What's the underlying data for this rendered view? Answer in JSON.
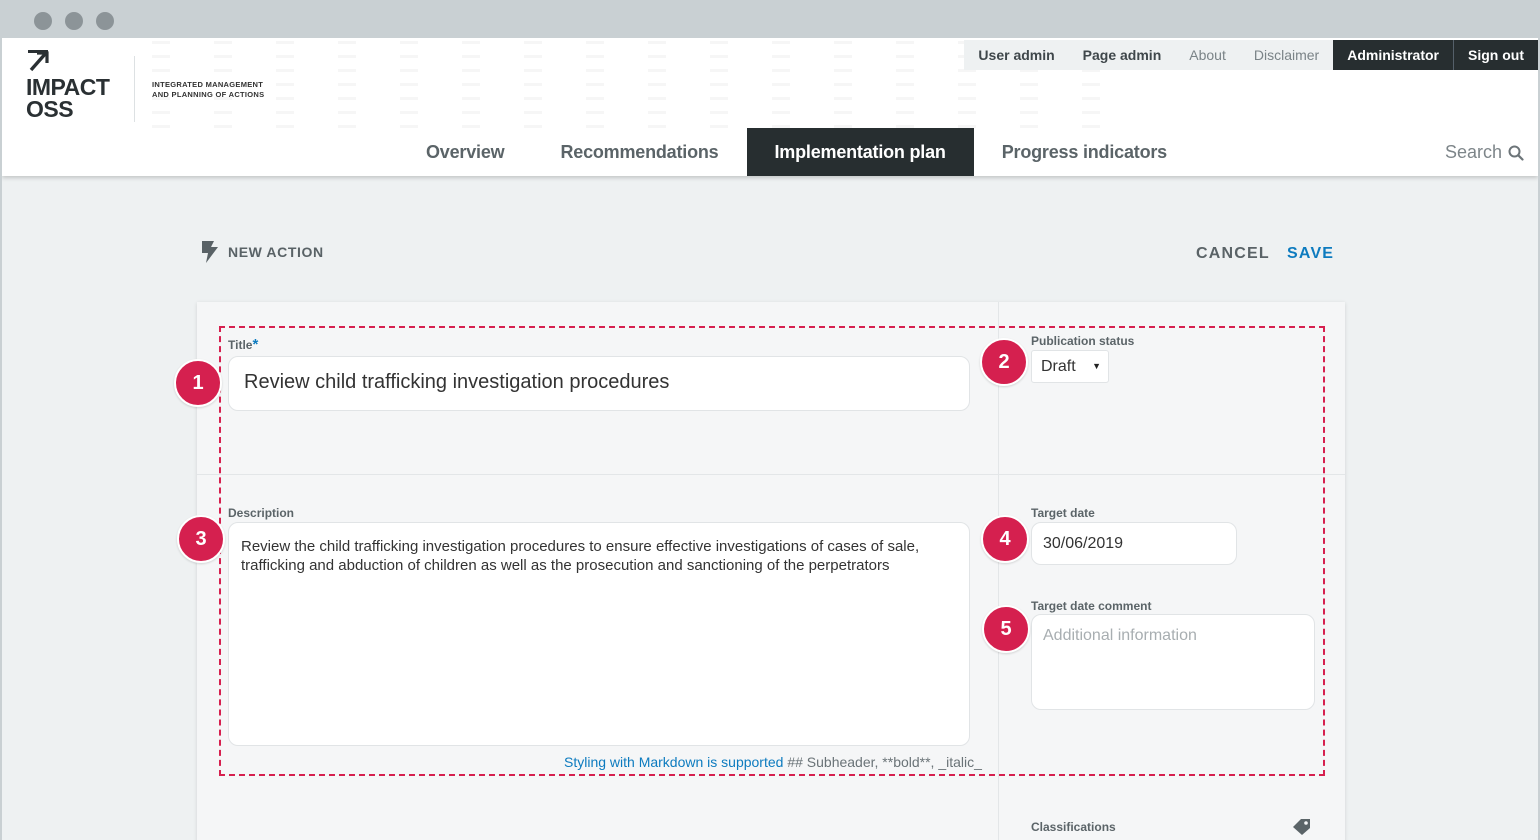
{
  "brand": {
    "logo_text_line1": "IMPACT",
    "logo_text_line2": "OSS",
    "tagline_line1": "INTEGRATED MANAGEMENT",
    "tagline_line2": "AND PLANNING OF ACTIONS"
  },
  "top_nav": {
    "items": [
      "User admin",
      "Page admin",
      "About",
      "Disclaimer",
      "Administrator",
      "Sign out"
    ]
  },
  "main_nav": {
    "tabs": [
      "Overview",
      "Recommendations",
      "Implementation plan",
      "Progress indicators"
    ],
    "active": "Implementation plan",
    "search_label": "Search"
  },
  "action_bar": {
    "title": "NEW ACTION",
    "cancel_label": "CANCEL",
    "save_label": "SAVE"
  },
  "form": {
    "title_label": "Title",
    "title_required_mark": "*",
    "title_value": "Review child trafficking investigation procedures",
    "publication_status_label": "Publication status",
    "publication_status_value": "Draft",
    "description_label": "Description",
    "description_value": "Review the child trafficking investigation procedures to ensure effective investigations of cases of sale, trafficking and abduction of children as well as the prosecution and sanctioning of the perpetrators",
    "markdown_link": "Styling with Markdown is supported",
    "markdown_hint": " ## Subheader, **bold**, _italic_",
    "target_date_label": "Target date",
    "target_date_value": "30/06/2019",
    "target_date_comment_label": "Target date comment",
    "target_date_comment_placeholder": "Additional information",
    "classifications_label": "Classifications"
  },
  "badges": [
    "1",
    "2",
    "3",
    "4",
    "5"
  ],
  "colors": {
    "accent": "#0d7bbf",
    "highlight": "#d5204f",
    "dark": "#272e30"
  }
}
